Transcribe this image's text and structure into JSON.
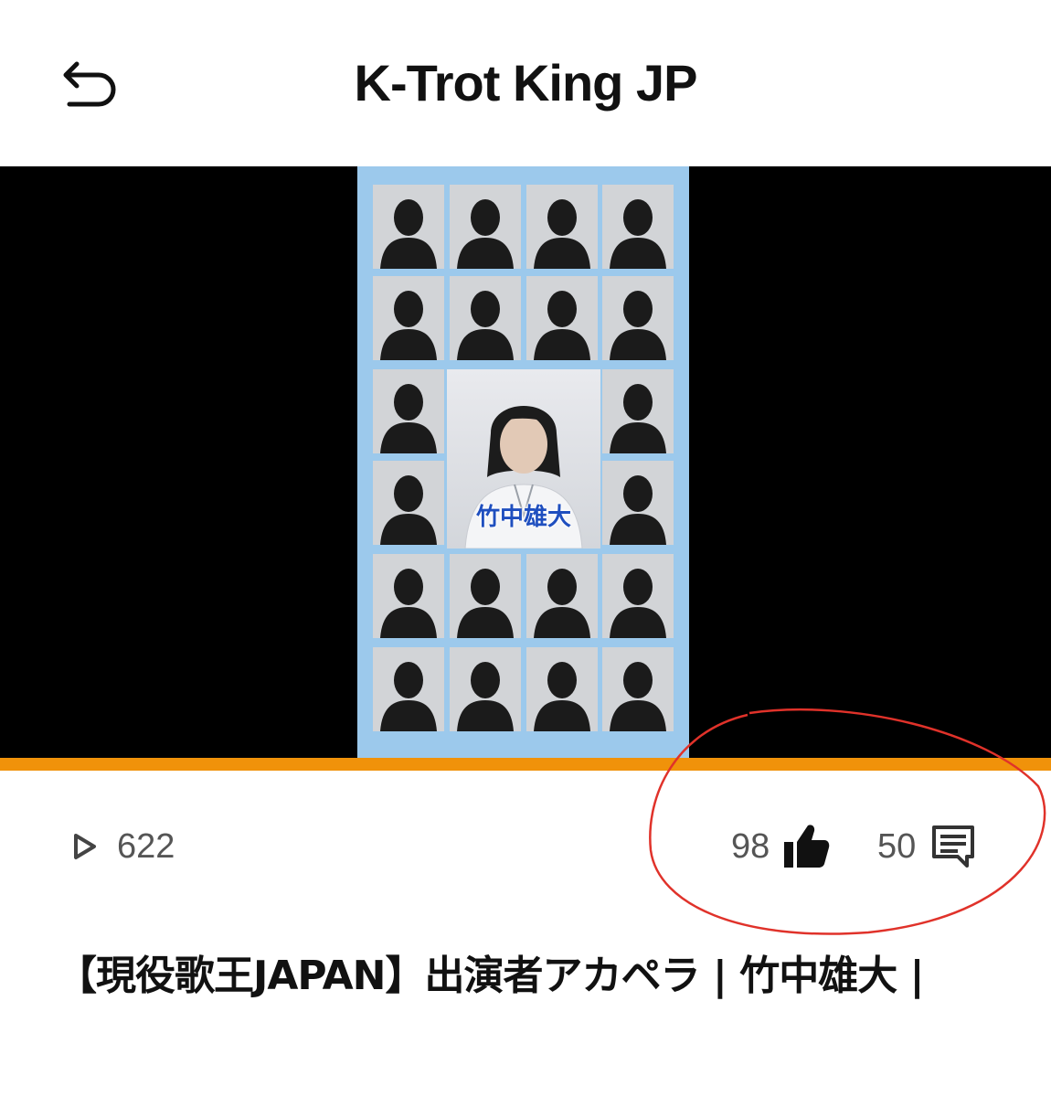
{
  "header": {
    "back_icon": "back-arrow-icon",
    "title": "K-Trot King JP"
  },
  "player": {
    "caption_name": "竹中雄大",
    "progress_color": "#f0920a",
    "progress_fraction": 1.0
  },
  "stats": {
    "views": "622",
    "views_icon": "play-icon",
    "likes": "98",
    "likes_icon": "thumbs-up-icon",
    "comments": "50",
    "comments_icon": "comment-icon"
  },
  "annotation": {
    "shape": "hand-drawn red ellipse around likes and comments",
    "color": "#e0322a"
  },
  "video": {
    "title": "【現役歌王JAPAN】出演者アカペラ | 竹中雄大 |"
  }
}
